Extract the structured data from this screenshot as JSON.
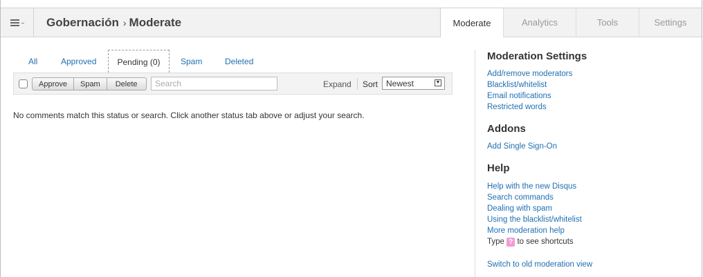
{
  "header": {
    "site": "Gobernación",
    "section": "Moderate",
    "separator": "›",
    "tabs": [
      "Moderate",
      "Analytics",
      "Tools",
      "Settings"
    ]
  },
  "status_tabs": [
    "All",
    "Approved",
    "Pending (0)",
    "Spam",
    "Deleted"
  ],
  "toolbar": {
    "approve": "Approve",
    "spam": "Spam",
    "delete": "Delete",
    "search_placeholder": "Search",
    "expand": "Expand",
    "sort_label": "Sort",
    "sort_value": "Newest"
  },
  "empty_message": "No comments match this status or search. Click another status tab above or adjust your search.",
  "sidebar": {
    "settings_title": "Moderation Settings",
    "settings_links": [
      "Add/remove moderators",
      "Blacklist/whitelist",
      "Email notifications",
      "Restricted words"
    ],
    "addons_title": "Addons",
    "addons_links": [
      "Add Single Sign-On"
    ],
    "help_title": "Help",
    "help_links": [
      "Help with the new Disqus",
      "Search commands",
      "Dealing with spam",
      "Using the blacklist/whitelist",
      "More moderation help"
    ],
    "shortcut_pre": "Type",
    "shortcut_key": "?",
    "shortcut_post": "to see shortcuts",
    "old_view_link": "Switch to old moderation view"
  },
  "colors": {
    "link": "#1f6fb2",
    "shortcut_key_bg": "#f29bd6"
  }
}
